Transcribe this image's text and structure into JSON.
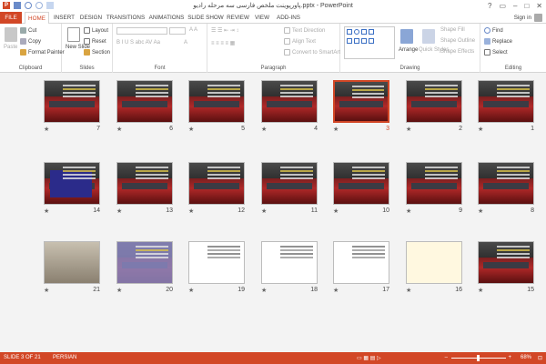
{
  "app": {
    "title": "پاورپوینت ملخص فارسی سه مرحله رادیو.pptx - PowerPoint",
    "signin": "Sign in"
  },
  "tabs": [
    "FILE",
    "HOME",
    "INSERT",
    "DESIGN",
    "TRANSITIONS",
    "ANIMATIONS",
    "SLIDE SHOW",
    "REVIEW",
    "VIEW",
    "ADD-INS"
  ],
  "ribbon": {
    "clipboard": {
      "paste": "Paste",
      "cut": "Cut",
      "copy": "Copy",
      "format_painter": "Format Painter",
      "label": "Clipboard"
    },
    "slides": {
      "new_slide": "New Slide",
      "layout": "Layout",
      "reset": "Reset",
      "section": "Section",
      "label": "Slides"
    },
    "font": {
      "label": "Font"
    },
    "paragraph": {
      "text_direction": "Text Direction",
      "align_text": "Align Text",
      "convert_smartart": "Convert to SmartArt",
      "label": "Paragraph"
    },
    "drawing": {
      "arrange": "Arrange",
      "quick_styles": "Quick Styles",
      "shape_fill": "Shape Fill",
      "shape_outline": "Shape Outline",
      "shape_effects": "Shape Effects",
      "label": "Drawing"
    },
    "editing": {
      "find": "Find",
      "replace": "Replace",
      "select": "Select",
      "label": "Editing"
    }
  },
  "slides": [
    {
      "n": "7",
      "style": "dark"
    },
    {
      "n": "6",
      "style": "dark"
    },
    {
      "n": "5",
      "style": "dark"
    },
    {
      "n": "4",
      "style": "dark"
    },
    {
      "n": "3",
      "style": "dark",
      "selected": true
    },
    {
      "n": "2",
      "style": "dark"
    },
    {
      "n": "1",
      "style": "dark"
    },
    {
      "n": "14",
      "style": "blue"
    },
    {
      "n": "13",
      "style": "dark"
    },
    {
      "n": "12",
      "style": "dark"
    },
    {
      "n": "11",
      "style": "dark"
    },
    {
      "n": "10",
      "style": "dark"
    },
    {
      "n": "9",
      "style": "dark"
    },
    {
      "n": "8",
      "style": "dark"
    },
    {
      "n": "21",
      "style": "photo"
    },
    {
      "n": "20",
      "style": "purple"
    },
    {
      "n": "19",
      "style": "light"
    },
    {
      "n": "18",
      "style": "light"
    },
    {
      "n": "17",
      "style": "light"
    },
    {
      "n": "16",
      "style": "cream"
    },
    {
      "n": "15",
      "style": "dark"
    }
  ],
  "status": {
    "slide_info": "SLIDE 3 OF 21",
    "language": "PERSIAN",
    "zoom": "68%"
  }
}
